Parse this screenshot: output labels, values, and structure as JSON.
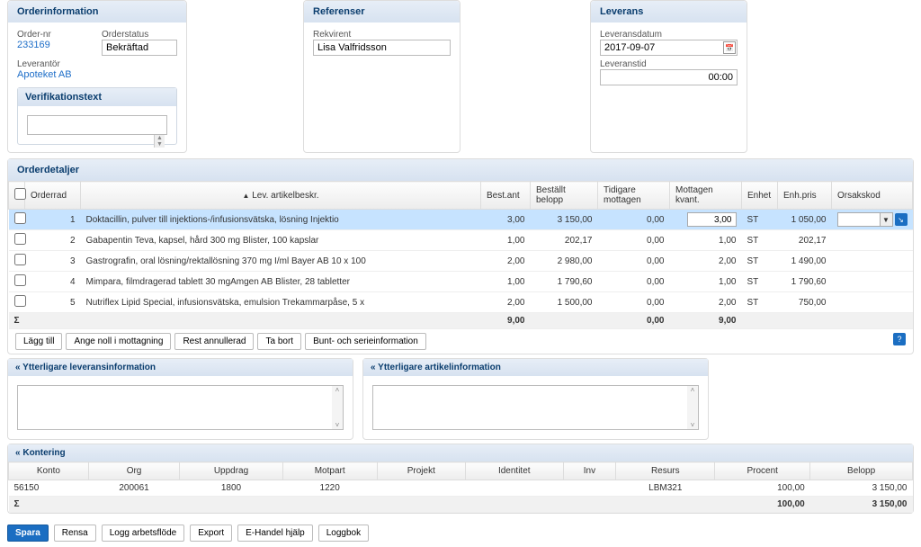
{
  "panels": {
    "orderinfo_title": "Orderinformation",
    "referenser_title": "Referenser",
    "leverans_title": "Leverans",
    "verif_title": "Verifikationstext",
    "detail_title": "Orderdetaljer",
    "sub1_title": "Ytterligare leveransinformation",
    "sub2_title": "Ytterligare artikelinformation",
    "kontering_title": "Kontering"
  },
  "orderinfo": {
    "ordernr_label": "Order-nr",
    "ordernr": "233169",
    "orderstatus_label": "Orderstatus",
    "orderstatus": "Bekräftad",
    "leverantor_label": "Leverantör",
    "leverantor": "Apoteket AB"
  },
  "referenser": {
    "rekvirent_label": "Rekvirent",
    "rekvirent": "Lisa Valfridsson"
  },
  "leverans": {
    "datum_label": "Leveransdatum",
    "datum": "2017-09-07",
    "tid_label": "Leveranstid",
    "tid": "00:00"
  },
  "grid": {
    "headers": {
      "chk": "",
      "orderrad": "Orderrad",
      "beskr": "Lev. artikelbeskr.",
      "bestant": "Best.ant",
      "belopp": "Beställt belopp",
      "tidigare": "Tidigare mottagen",
      "mottagen": "Mottagen kvant.",
      "enhet": "Enhet",
      "enhpris": "Enh.pris",
      "orsak": "Orsakskod"
    },
    "rows": [
      {
        "rad": "1",
        "beskr": "Doktacillin, pulver till injektions-/infusionsvätska, lösning Injektio",
        "bestant": "3,00",
        "belopp": "3 150,00",
        "tidigare": "0,00",
        "mottagen": "3,00",
        "enhet": "ST",
        "enhpris": "1 050,00"
      },
      {
        "rad": "2",
        "beskr": "Gabapentin Teva, kapsel, hård 300 mg Blister, 100 kapslar",
        "bestant": "1,00",
        "belopp": "202,17",
        "tidigare": "0,00",
        "mottagen": "1,00",
        "enhet": "ST",
        "enhpris": "202,17"
      },
      {
        "rad": "3",
        "beskr": "Gastrografin, oral lösning/rektallösning 370 mg I/ml Bayer AB 10 x 100",
        "bestant": "2,00",
        "belopp": "2 980,00",
        "tidigare": "0,00",
        "mottagen": "2,00",
        "enhet": "ST",
        "enhpris": "1 490,00"
      },
      {
        "rad": "4",
        "beskr": "Mimpara, filmdragerad tablett 30 mgAmgen AB Blister, 28 tabletter",
        "bestant": "1,00",
        "belopp": "1 790,60",
        "tidigare": "0,00",
        "mottagen": "1,00",
        "enhet": "ST",
        "enhpris": "1 790,60"
      },
      {
        "rad": "5",
        "beskr": "Nutriflex Lipid Special, infusionsvätska, emulsion Trekammarpåse, 5 x",
        "bestant": "2,00",
        "belopp": "1 500,00",
        "tidigare": "0,00",
        "mottagen": "2,00",
        "enhet": "ST",
        "enhpris": "750,00"
      }
    ],
    "sum": {
      "sigma": "Σ",
      "bestant": "9,00",
      "tidigare": "0,00",
      "mottagen": "9,00"
    }
  },
  "buttons": {
    "lagg_till": "Lägg till",
    "ange_noll": "Ange noll i mottagning",
    "rest_annullerad": "Rest annullerad",
    "ta_bort": "Ta bort",
    "bunt": "Bunt- och serieinformation"
  },
  "kontering": {
    "headers": {
      "konto": "Konto",
      "org": "Org",
      "uppdrag": "Uppdrag",
      "motpart": "Motpart",
      "projekt": "Projekt",
      "identitet": "Identitet",
      "inv": "Inv",
      "resurs": "Resurs",
      "procent": "Procent",
      "belopp": "Belopp"
    },
    "rows": [
      {
        "konto": "56150",
        "org": "200061",
        "uppdrag": "1800",
        "motpart": "1220",
        "projekt": "",
        "identitet": "",
        "inv": "",
        "resurs": "LBM321",
        "procent": "100,00",
        "belopp": "3 150,00"
      }
    ],
    "sum": {
      "sigma": "Σ",
      "procent": "100,00",
      "belopp": "3 150,00"
    }
  },
  "footer": {
    "spara": "Spara",
    "rensa": "Rensa",
    "logg": "Logg arbetsflöde",
    "export": "Export",
    "ehandel": "E-Handel hjälp",
    "loggbok": "Loggbok"
  },
  "chevron": "«"
}
